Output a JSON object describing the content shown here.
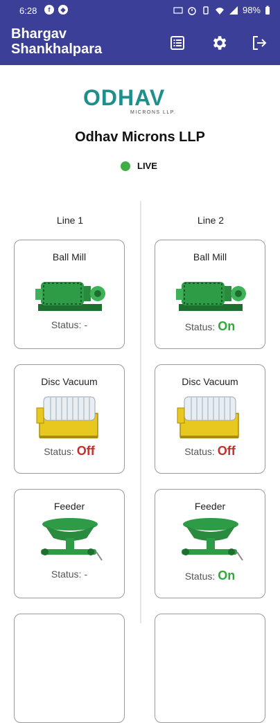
{
  "status_bar": {
    "time": "6:28",
    "battery": "98%",
    "icons": [
      "f-icon",
      "shield-icon",
      "data-icon",
      "alarm-icon",
      "vibrate-icon",
      "wifi-icon",
      "signal-icon",
      "battery-icon"
    ]
  },
  "appbar": {
    "title_line1": "Bhargav",
    "title_line2": "Shankhalpara",
    "color": "#3b3f98",
    "actions": [
      "list-icon",
      "gear-icon",
      "logout-icon"
    ]
  },
  "logo": {
    "text": "ODHAV",
    "sub": "MICRONS LLP"
  },
  "company": "Odhav Microns LLP",
  "live_label": "LIVE",
  "lines": [
    {
      "label": "Line 1",
      "machines": [
        {
          "name": "Ball Mill",
          "status_label": "Status:",
          "status": "-",
          "image": "ball-mill"
        },
        {
          "name": "Disc Vacuum",
          "status_label": "Status:",
          "status": "Off",
          "image": "disc-vacuum"
        },
        {
          "name": "Feeder",
          "status_label": "Status:",
          "status": "-",
          "image": "feeder"
        }
      ]
    },
    {
      "label": "Line 2",
      "machines": [
        {
          "name": "Ball Mill",
          "status_label": "Status:",
          "status": "On",
          "image": "ball-mill"
        },
        {
          "name": "Disc Vacuum",
          "status_label": "Status:",
          "status": "Off",
          "image": "disc-vacuum"
        },
        {
          "name": "Feeder",
          "status_label": "Status:",
          "status": "On",
          "image": "feeder"
        }
      ]
    }
  ],
  "colors": {
    "on": "#2faa3a",
    "off": "#c62f2a",
    "live": "#3fae46",
    "teal": "#1f8f8c"
  }
}
